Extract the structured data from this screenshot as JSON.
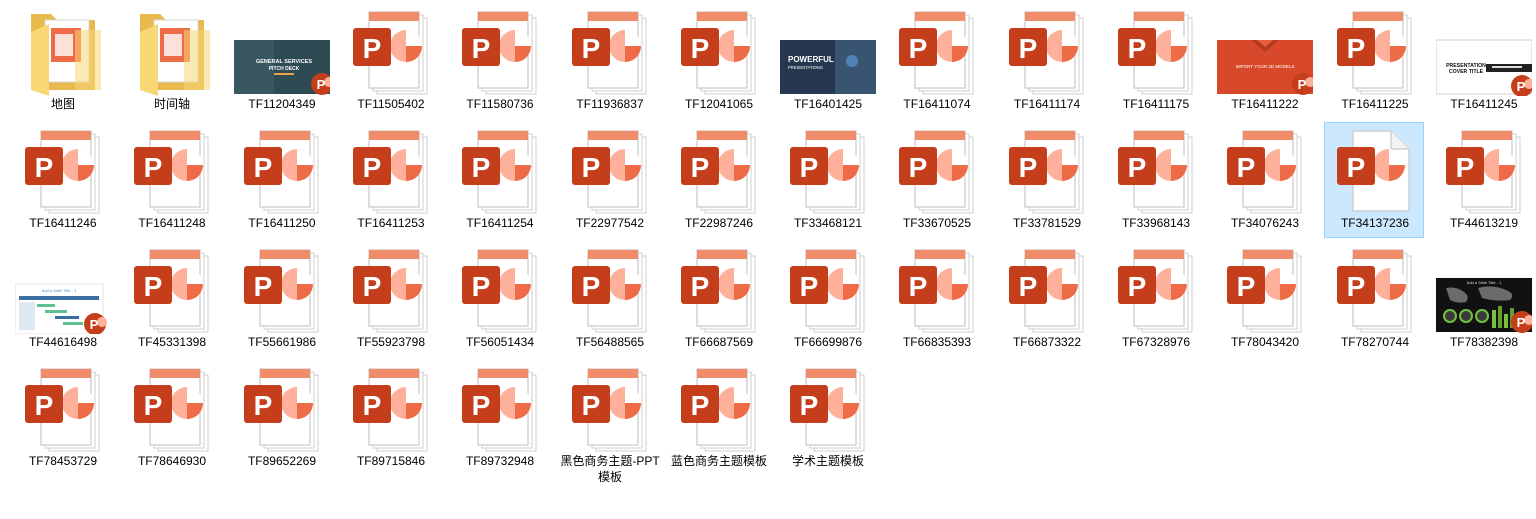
{
  "colors": {
    "ppt_red": "#c43e1c",
    "ppt_tab": "#f08c69",
    "ppt_pie": "#ed6c47",
    "ppt_pie_light": "#ffb09a",
    "folder_yellow": "#f8d775",
    "folder_dark": "#e8b94d",
    "selection_fill": "#cce8ff",
    "selection_border": "#99d1ff"
  },
  "items": [
    {
      "name": "地图",
      "icon": "folder",
      "selected": false
    },
    {
      "name": "时间轴",
      "icon": "folder",
      "selected": false
    },
    {
      "name": "TF11204349",
      "icon": "thumb-general-services",
      "selected": false,
      "thumb_title": "GENERAL SERVICES",
      "thumb_subtitle": "PITCH DECK"
    },
    {
      "name": "TF11505402",
      "icon": "ppt",
      "selected": false
    },
    {
      "name": "TF11580736",
      "icon": "ppt",
      "selected": false
    },
    {
      "name": "TF11936837",
      "icon": "ppt",
      "selected": false
    },
    {
      "name": "TF12041065",
      "icon": "ppt",
      "selected": false
    },
    {
      "name": "TF16401425",
      "icon": "thumb-powerful",
      "selected": false,
      "thumb_title": "POWERFUL",
      "thumb_subtitle": "PRESENTATIONS"
    },
    {
      "name": "TF16411074",
      "icon": "ppt",
      "selected": false
    },
    {
      "name": "TF16411174",
      "icon": "ppt",
      "selected": false
    },
    {
      "name": "TF16411175",
      "icon": "ppt",
      "selected": false
    },
    {
      "name": "TF16411222",
      "icon": "thumb-3d-models",
      "selected": false,
      "thumb_title": "IMPORT YOUR 3D MODELS"
    },
    {
      "name": "TF16411225",
      "icon": "ppt",
      "selected": false
    },
    {
      "name": "TF16411245",
      "icon": "thumb-cover-title",
      "selected": false,
      "thumb_title": "PRESENTATION",
      "thumb_subtitle": "COVER TITLE"
    },
    {
      "name": "TF16411246",
      "icon": "ppt",
      "selected": false
    },
    {
      "name": "TF16411248",
      "icon": "ppt",
      "selected": false
    },
    {
      "name": "TF16411250",
      "icon": "ppt",
      "selected": false
    },
    {
      "name": "TF16411253",
      "icon": "ppt",
      "selected": false
    },
    {
      "name": "TF16411254",
      "icon": "ppt",
      "selected": false
    },
    {
      "name": "TF22977542",
      "icon": "ppt",
      "selected": false
    },
    {
      "name": "TF22987246",
      "icon": "ppt",
      "selected": false
    },
    {
      "name": "TF33468121",
      "icon": "ppt",
      "selected": false
    },
    {
      "name": "TF33670525",
      "icon": "ppt",
      "selected": false
    },
    {
      "name": "TF33781529",
      "icon": "ppt",
      "selected": false
    },
    {
      "name": "TF33968143",
      "icon": "ppt",
      "selected": false
    },
    {
      "name": "TF34076243",
      "icon": "ppt",
      "selected": false
    },
    {
      "name": "TF34137236",
      "icon": "ppt-doc",
      "selected": true
    },
    {
      "name": "TF44613219",
      "icon": "ppt",
      "selected": false
    },
    {
      "name": "TF44616498",
      "icon": "thumb-gantt",
      "selected": false,
      "thumb_title": "Add a Slide Title - 1"
    },
    {
      "name": "TF45331398",
      "icon": "ppt",
      "selected": false
    },
    {
      "name": "TF55661986",
      "icon": "ppt",
      "selected": false
    },
    {
      "name": "TF55923798",
      "icon": "ppt",
      "selected": false
    },
    {
      "name": "TF56051434",
      "icon": "ppt",
      "selected": false
    },
    {
      "name": "TF56488565",
      "icon": "ppt",
      "selected": false
    },
    {
      "name": "TF66687569",
      "icon": "ppt",
      "selected": false
    },
    {
      "name": "TF66699876",
      "icon": "ppt",
      "selected": false
    },
    {
      "name": "TF66835393",
      "icon": "ppt",
      "selected": false
    },
    {
      "name": "TF66873322",
      "icon": "ppt",
      "selected": false
    },
    {
      "name": "TF67328976",
      "icon": "ppt",
      "selected": false
    },
    {
      "name": "TF78043420",
      "icon": "ppt",
      "selected": false
    },
    {
      "name": "TF78270744",
      "icon": "ppt",
      "selected": false
    },
    {
      "name": "TF78382398",
      "icon": "thumb-world-map",
      "selected": false,
      "thumb_title": "Add a Slide Title - 1"
    },
    {
      "name": "TF78453729",
      "icon": "ppt",
      "selected": false
    },
    {
      "name": "TF78646930",
      "icon": "ppt",
      "selected": false
    },
    {
      "name": "TF89652269",
      "icon": "ppt",
      "selected": false
    },
    {
      "name": "TF89715846",
      "icon": "ppt",
      "selected": false
    },
    {
      "name": "TF89732948",
      "icon": "ppt",
      "selected": false
    },
    {
      "name": "黑色商务主题-PPT模板",
      "icon": "ppt",
      "selected": false
    },
    {
      "name": "蓝色商务主题模板",
      "icon": "ppt",
      "selected": false
    },
    {
      "name": "学术主题模板",
      "icon": "ppt",
      "selected": false
    }
  ]
}
